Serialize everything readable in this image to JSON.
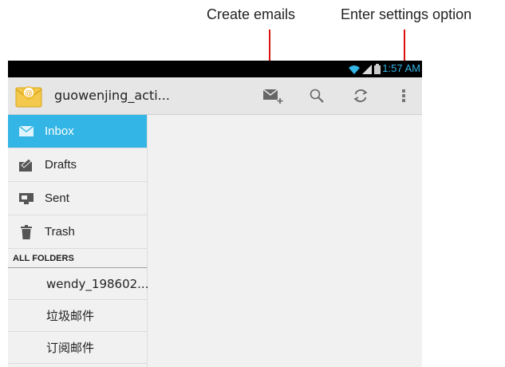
{
  "annotations": {
    "create": "Create emails",
    "settings": "Enter settings option"
  },
  "status_bar": {
    "time": "1:57 AM",
    "icons": [
      "wifi-icon",
      "signal-icon",
      "battery-icon"
    ]
  },
  "action_bar": {
    "account": "guowenjing_acti...",
    "icons": [
      "email-app-icon",
      "compose-icon",
      "search-icon",
      "refresh-icon",
      "overflow-menu-icon"
    ]
  },
  "drawer": {
    "items": [
      {
        "label": "Inbox",
        "icon": "inbox-icon",
        "selected": true
      },
      {
        "label": "Drafts",
        "icon": "drafts-icon",
        "selected": false
      },
      {
        "label": "Sent",
        "icon": "sent-icon",
        "selected": false
      },
      {
        "label": "Trash",
        "icon": "trash-icon",
        "selected": false
      }
    ],
    "section_header": "ALL FOLDERS",
    "folders": [
      "wendy_198602...",
      "垃圾邮件",
      "订阅邮件"
    ]
  },
  "colors": {
    "accent": "#33b5e5",
    "annotation": "#dd1111",
    "actionbar_bg": "#e6e6e6",
    "background": "#f1f1f1"
  }
}
